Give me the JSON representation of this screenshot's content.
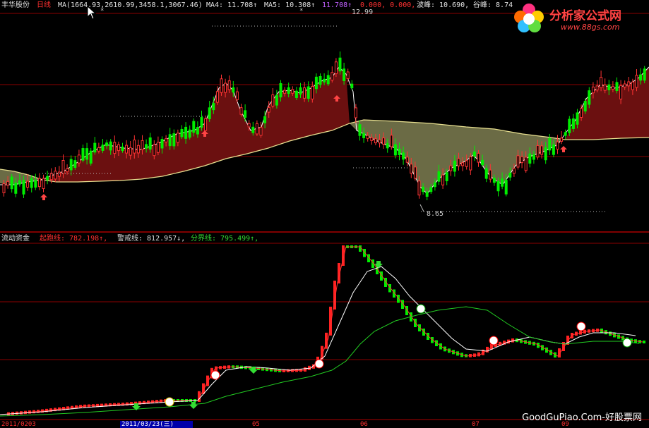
{
  "header": {
    "stock_name": "丰华股份",
    "period": "日线",
    "ma_label": "MA(1664.93,2610.99,3458.1,3067.46)",
    "ma4_text": "MA4: 11.708↑",
    "ma5_text": "MA5: 10.308↑",
    "purple_text": "11.708↑",
    "red_text": "0.000, 0.000,",
    "peak_text": "波峰: 10.690,",
    "valley_text": "谷峰: 8.74"
  },
  "logo": {
    "title": "分析家公式网",
    "url": "www.88gs.com"
  },
  "main_chart": {
    "high_label": "12.99",
    "low_label": "8.65"
  },
  "indicator": {
    "name": "流动资金",
    "line1_text": "起跑线: 782.198↑,",
    "line2_text": "警戒线: 812.957↓,",
    "line3_text": "分界线: 795.499↑,"
  },
  "date_axis": {
    "start": "2011/0203",
    "selected": "2011/03/23(三)",
    "m05": "05",
    "m06": "06",
    "m07": "07",
    "m09": "09"
  },
  "watermark": "GoodGuPiao.Com-好股票网",
  "colors": {
    "up": "#ff3333",
    "down": "#00ff00",
    "fill_red": "#6b1010",
    "fill_olive": "#6b6b45",
    "grid": "#8b0000"
  }
}
